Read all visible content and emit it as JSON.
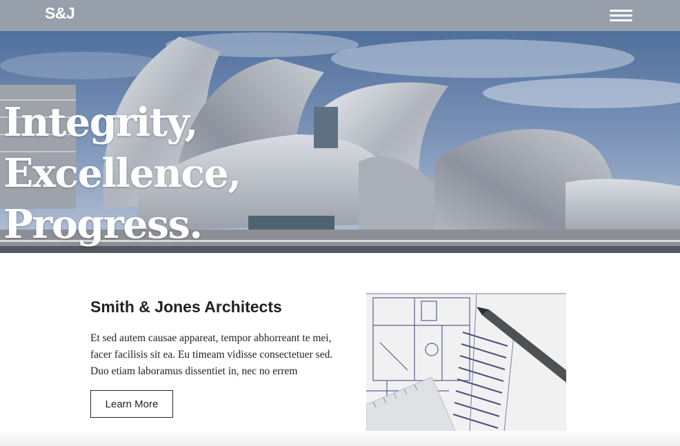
{
  "header": {
    "logo_text": "S&J",
    "menu_icon": "hamburger-menu-icon"
  },
  "hero": {
    "title_lines": [
      "Integrity,",
      "Excellence,",
      "Progress."
    ],
    "image_subject": "curved stainless-steel concert hall under a cloudy blue sky"
  },
  "intro": {
    "heading": "Smith & Jones Architects",
    "body": "Et sed autem causae appareat, tempor abhorreant te mei, facer facilisis sit ea. Eu timeam vidisse consectetuer sed. Duo etiam laboramus dissentiet in, nec no errem",
    "button_label": "Learn More",
    "image_subject": "architectural floor plan drawing with a pen and ruler"
  },
  "colors": {
    "navbar": "#979fab",
    "text": "#222222",
    "white": "#ffffff"
  }
}
